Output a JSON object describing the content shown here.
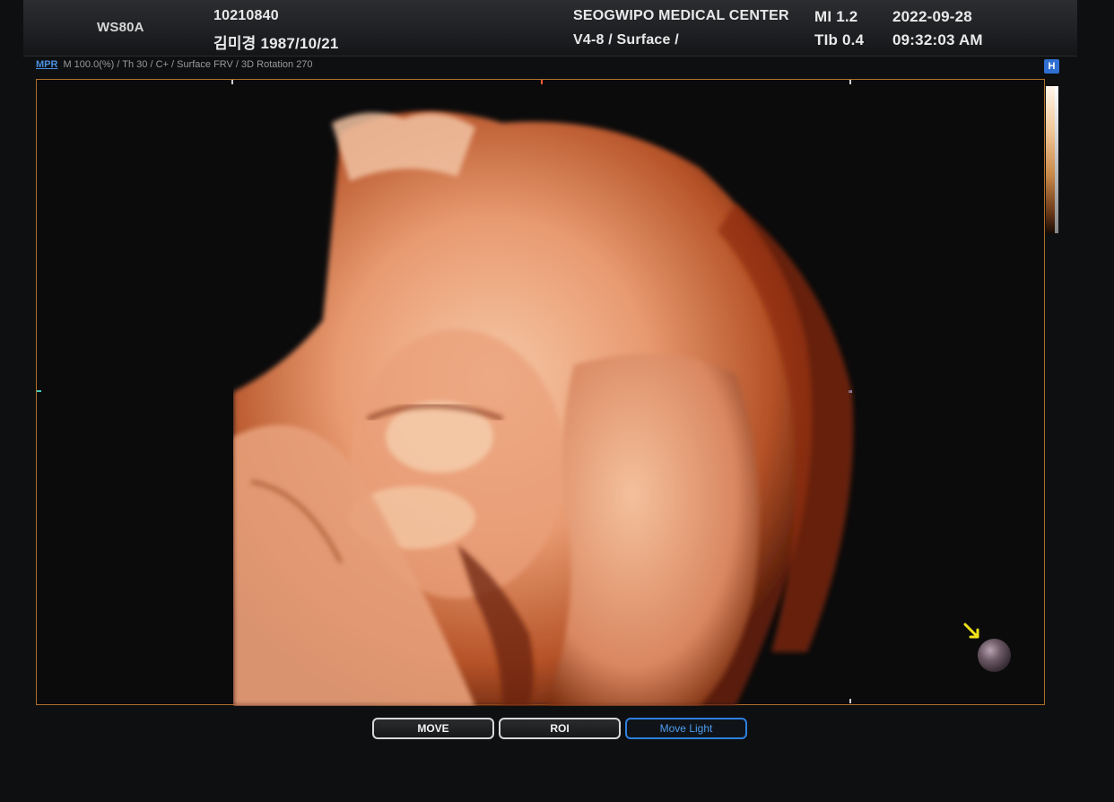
{
  "header": {
    "model": "WS80A",
    "patient_id": "10210840",
    "patient_name_dob": "김미경 1987/10/21",
    "center": "SEOGWIPO MEDICAL CENTER",
    "probe_mode": "V4-8 / Surface /",
    "mi": "MI  1.2",
    "tib": "TIb 0.4",
    "date": "2022-09-28",
    "time": "09:32:03 AM"
  },
  "infobar": {
    "mpr_label": "MPR",
    "params": "M 100.0(%) / Th 30 / C+ / Surface FRV / 3D Rotation 270",
    "badge": "H"
  },
  "light": {
    "icon": "light-source-icon",
    "arrow_color": "#f2e21a"
  },
  "buttons": {
    "move": "MOVE",
    "roi": "ROI",
    "move_light": "Move Light"
  },
  "colors": {
    "accent": "#2f7fe0",
    "frame": "#b0702a",
    "render_tone": "#e8a07a"
  }
}
